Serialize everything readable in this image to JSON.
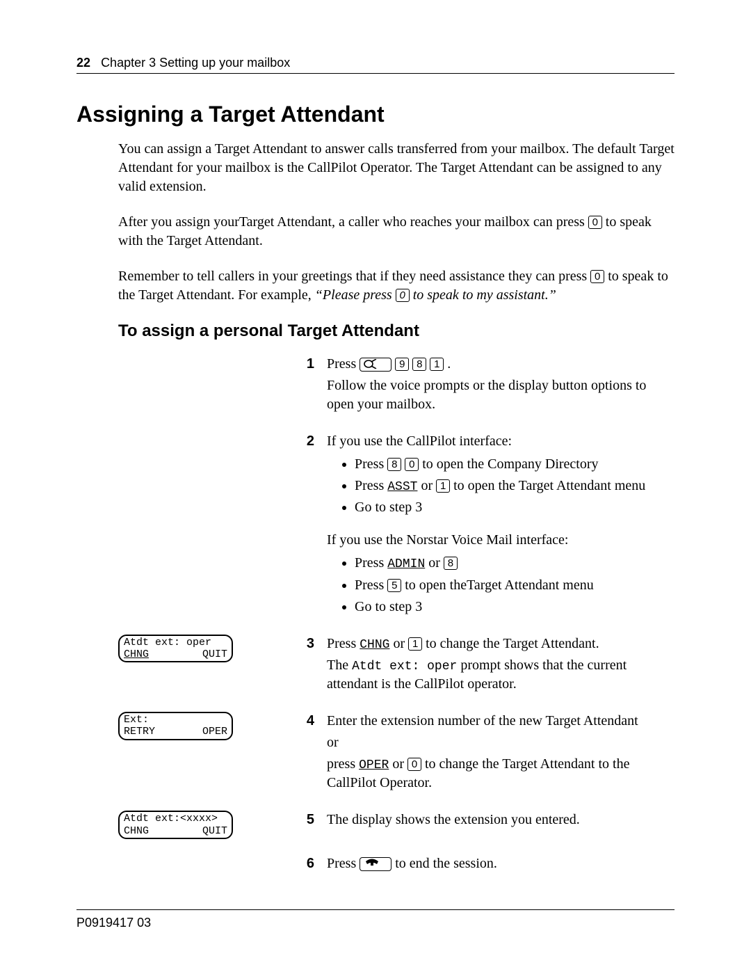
{
  "header": {
    "page_number": "22",
    "chapter": "Chapter 3  Setting up your mailbox"
  },
  "title": "Assigning a Target Attendant",
  "intro": {
    "p1": "You can assign a Target Attendant to answer calls transferred from your mailbox. The default Target Attendant for your mailbox is the CallPilot Operator. The Target Attendant can be assigned to any valid extension.",
    "p2a": "After you assign yourTarget Attendant, a caller who reaches your mailbox can press ",
    "p2b": " to speak with the Target Attendant.",
    "p3a": "Remember to tell callers in your greetings that if they need assistance they can press ",
    "p3b": " to speak to the Target Attendant. For example, ",
    "p3c": "“Please press ",
    "p3d": " to speak to my assistant.”"
  },
  "subtitle": "To assign a personal Target Attendant",
  "keys": {
    "zero": "0",
    "one": "1",
    "five": "5",
    "eight": "8",
    "nine": "9"
  },
  "soft": {
    "asst": "ASST",
    "admin": "ADMIN",
    "chng": "CHNG",
    "oper": "OPER",
    "quit": "QUIT",
    "retry": "RETRY"
  },
  "displays": {
    "d1_line1": "Atdt ext: oper",
    "d1_left": "CHNG",
    "d1_right": "QUIT",
    "d2_line1": "Ext:",
    "d2_left": "RETRY",
    "d2_right": "OPER",
    "d3_line1": "Atdt ext:<xxxx>",
    "d3_left": "CHNG",
    "d3_right": "QUIT"
  },
  "steps": {
    "s1": {
      "num": "1",
      "a": "Press ",
      "b": ".",
      "c": "Follow the voice prompts or the display button options to open your mailbox."
    },
    "s2": {
      "num": "2",
      "a": "If you use the CallPilot interface:",
      "b1a": "Press ",
      "b1b": " to open the Company Directory",
      "b2a": "Press ",
      "b2b": " or ",
      "b2c": " to open the Target Attendant menu",
      "b3": "Go to step 3",
      "c": "If you use the Norstar Voice Mail interface:",
      "d1a": "Press ",
      "d1b": " or ",
      "d2a": "Press ",
      "d2b": " to open theTarget Attendant menu",
      "d3": "Go to step 3"
    },
    "s3": {
      "num": "3",
      "a": "Press ",
      "b": " or ",
      "c": " to change the Target Attendant.",
      "d": "The ",
      "e": "Atdt ext: oper",
      "f": " prompt shows that the current attendant is the CallPilot operator."
    },
    "s4": {
      "num": "4",
      "a": "Enter the extension number of the new Target Attendant",
      "b": "or",
      "c": "press ",
      "d": " or ",
      "e": " to change the Target Attendant to the CallPilot Operator."
    },
    "s5": {
      "num": "5",
      "a": "The display shows the extension you entered."
    },
    "s6": {
      "num": "6",
      "a": "Press ",
      "b": " to end the session."
    }
  },
  "footer": "P0919417 03"
}
